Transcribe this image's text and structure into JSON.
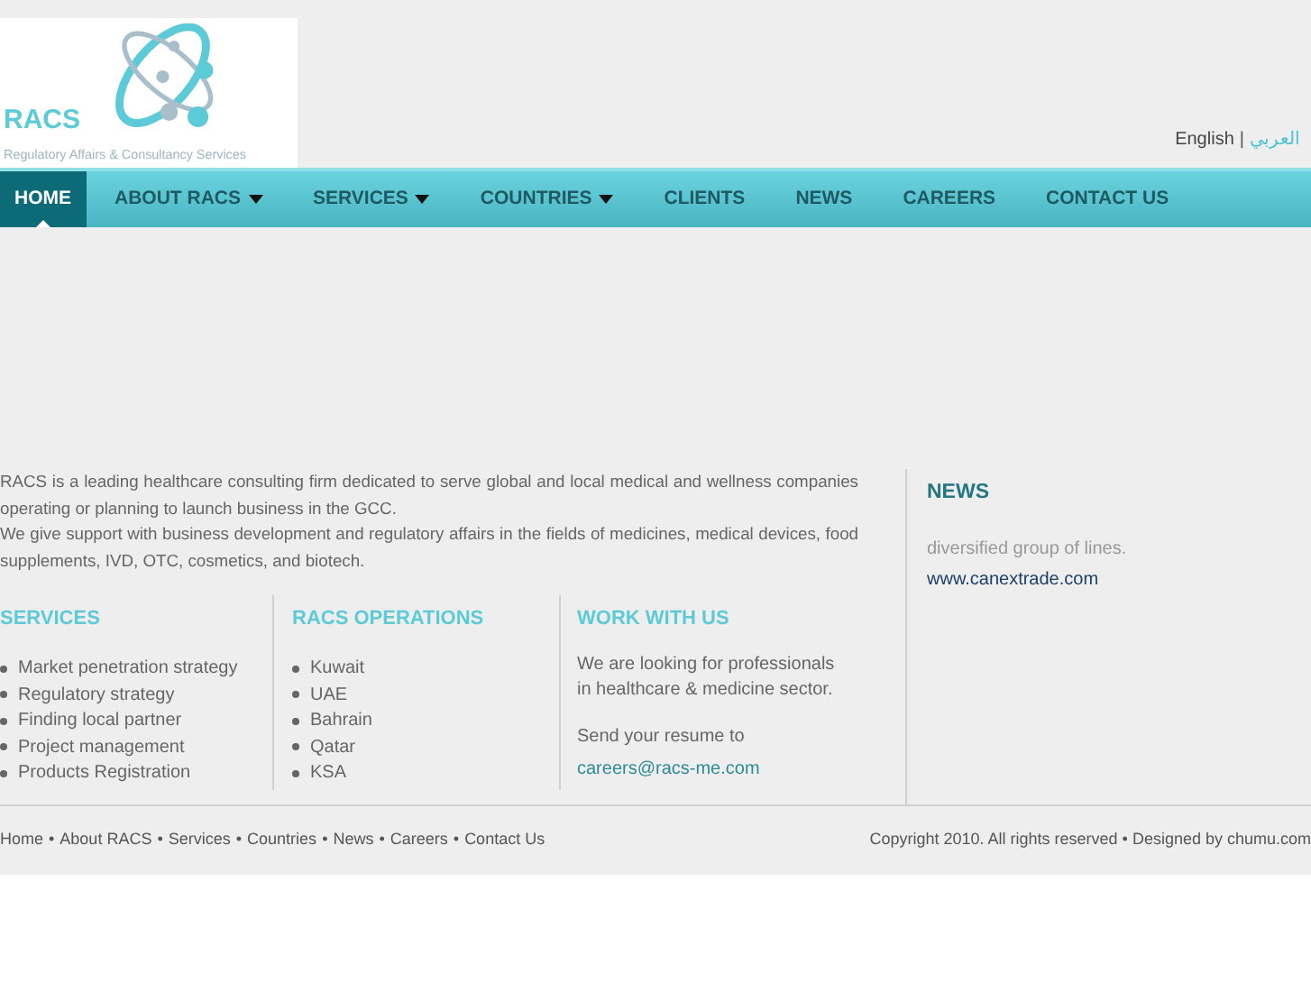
{
  "logo": {
    "name": "RACS",
    "tagline": "Regulatory Affairs & Consultancy Services"
  },
  "languages": [
    {
      "label": "English",
      "selected": true
    },
    {
      "label": "العربي",
      "selected": false
    }
  ],
  "language_separator": "|",
  "nav": [
    {
      "label": "HOME",
      "selected": true,
      "dropdown": false
    },
    {
      "label": "ABOUT RACS",
      "selected": false,
      "dropdown": true
    },
    {
      "label": "SERVICES",
      "selected": false,
      "dropdown": true
    },
    {
      "label": "COUNTRIES",
      "selected": false,
      "dropdown": true
    },
    {
      "label": "CLIENTS",
      "selected": false,
      "dropdown": false
    },
    {
      "label": "NEWS",
      "selected": false,
      "dropdown": false
    },
    {
      "label": "CAREERS",
      "selected": false,
      "dropdown": false
    },
    {
      "label": "CONTACT US",
      "selected": false,
      "dropdown": false
    }
  ],
  "intro": [
    "RACS is a leading healthcare consulting firm dedicated to serve global and local medical and wellness companies operating or planning to launch business in the GCC.",
    "We give support with business development and regulatory affairs in the fields of medicines, medical devices, food supplements, IVD, OTC, cosmetics, and biotech."
  ],
  "services": {
    "title": "SERVICES",
    "items": [
      "Market penetration strategy",
      "Regulatory strategy",
      "Finding local partner",
      "Project management",
      "Products Registration"
    ]
  },
  "operations": {
    "title": "RACS OPERATIONS",
    "items": [
      "Kuwait",
      "UAE",
      "Bahrain",
      "Qatar",
      "KSA"
    ]
  },
  "work": {
    "title": "WORK WITH US",
    "text": "We are looking for professionals in healthcare & medicine sector.",
    "resume": "Send your resume to",
    "email": "careers@racs-me.com"
  },
  "news": {
    "title": "NEWS",
    "text": "diversified group of lines.",
    "link": "www.canextrade.com"
  },
  "footer": {
    "links": [
      "Home",
      "About RACS",
      "Services",
      "Countries",
      "News",
      "Careers",
      "Contact Us"
    ],
    "separator": "•",
    "copyright": "Copyright 2010. All rights reserved • Designed by chumu.com"
  }
}
